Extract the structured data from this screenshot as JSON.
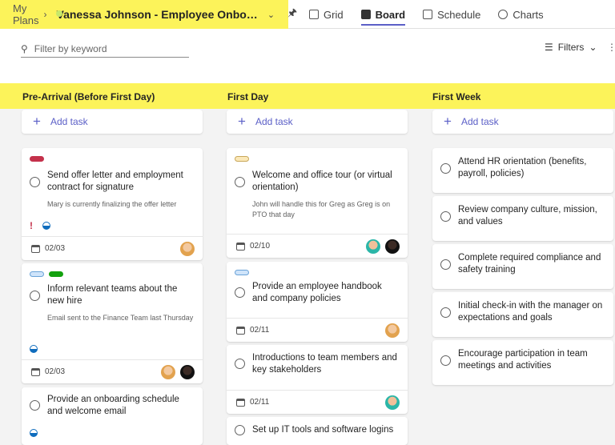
{
  "breadcrumb": {
    "root": "My Plans",
    "plan_title": "Vanessa Johnson - Employee Onbo…"
  },
  "views": {
    "grid": "Grid",
    "board": "Board",
    "schedule": "Schedule",
    "charts": "Charts",
    "active": "Board"
  },
  "search": {
    "placeholder": "Filter by keyword"
  },
  "filters": {
    "label": "Filters"
  },
  "colors": {
    "highlight": "#fcf35a",
    "accent": "#5b5fc7",
    "label_red": "#c4314b",
    "label_green": "#13a10e",
    "label_light_blue": "#cfe4fa",
    "label_beige": "#fbe8b8"
  },
  "buckets": [
    {
      "title": "Pre-Arrival (Before First Day)",
      "add_task": "Add task",
      "cards": [
        {
          "title": "Send offer letter and employment contract for signature",
          "note": "Mary is currently finalizing the offer letter",
          "urgent": "!",
          "date": "02/03",
          "labels": [
            "red"
          ],
          "avatars": [
            "tan"
          ]
        },
        {
          "title": "Inform relevant teams about the new hire",
          "note": "Email sent to the Finance Team last Thursday",
          "date": "02/03",
          "labels": [
            "light-blue",
            "green"
          ],
          "avatars": [
            "tan",
            "dark"
          ]
        },
        {
          "title": "Provide an onboarding schedule and welcome email"
        }
      ]
    },
    {
      "title": "First Day",
      "add_task": "Add task",
      "cards": [
        {
          "title": "Welcome and office tour (or virtual orientation)",
          "note": "John will handle this for Greg as Greg is on PTO that day",
          "date": "02/10",
          "labels": [
            "beige"
          ],
          "avatars": [
            "teal",
            "dark"
          ]
        },
        {
          "title": "Provide an employee handbook and company policies",
          "date": "02/11",
          "labels": [
            "light-blue"
          ],
          "avatars": [
            "tan"
          ]
        },
        {
          "title": "Introductions to team members and key stakeholders",
          "date": "02/11",
          "avatars": [
            "teal"
          ]
        },
        {
          "title": "Set up IT tools and software logins"
        }
      ]
    },
    {
      "title": "First Week",
      "add_task": "Add task",
      "cards": [
        {
          "title": "Attend HR orientation (benefits, payroll, policies)"
        },
        {
          "title": "Review company culture, mission, and values"
        },
        {
          "title": "Complete required compliance and safety training"
        },
        {
          "title": "Initial check-in with the manager on expectations and goals"
        },
        {
          "title": "Encourage participation in team meetings and activities"
        }
      ]
    }
  ]
}
